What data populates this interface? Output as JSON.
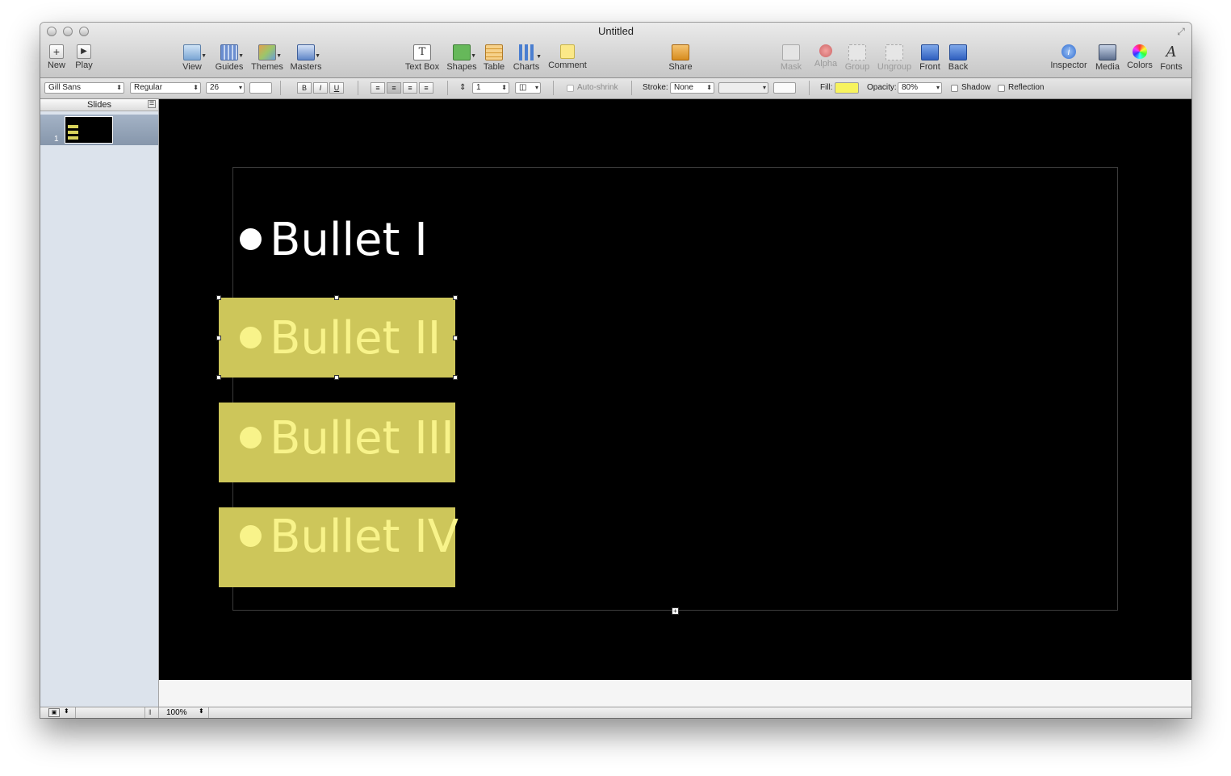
{
  "window": {
    "title": "Untitled"
  },
  "toolbar": {
    "new": "New",
    "play": "Play",
    "view": "View",
    "guides": "Guides",
    "themes": "Themes",
    "masters": "Masters",
    "text_box": "Text Box",
    "shapes": "Shapes",
    "table": "Table",
    "charts": "Charts",
    "comment": "Comment",
    "share": "Share",
    "mask": "Mask",
    "alpha": "Alpha",
    "group": "Group",
    "ungroup": "Ungroup",
    "front": "Front",
    "back": "Back",
    "inspector": "Inspector",
    "media": "Media",
    "colors": "Colors",
    "fonts": "Fonts"
  },
  "format": {
    "font_family": "Gill Sans",
    "font_style": "Regular",
    "font_size": "26",
    "bold": "B",
    "italic": "I",
    "underline": "U",
    "line_spacing": "1",
    "auto_shrink": "Auto-shrink",
    "stroke_label": "Stroke:",
    "stroke_value": "None",
    "fill_label": "Fill:",
    "fill_color": "#f7f35e",
    "opacity_label": "Opacity:",
    "opacity_value": "80%",
    "shadow": "Shadow",
    "reflection": "Reflection"
  },
  "sidebar": {
    "header": "Slides",
    "slide_number": "1"
  },
  "slide": {
    "bullets": [
      "Bullet  I",
      "Bullet II",
      "Bullet III",
      "Bullet IV"
    ]
  },
  "status": {
    "zoom": "100%"
  },
  "colors": {
    "highlight_box": "#cdc65a",
    "highlight_text": "#f8f38a",
    "slide_bg": "#000000"
  }
}
